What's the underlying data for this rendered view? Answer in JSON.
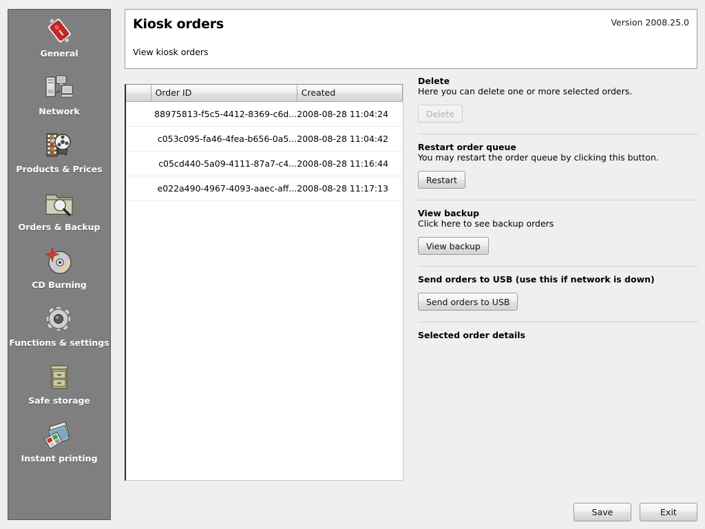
{
  "sidebar": {
    "items": [
      {
        "label": "General",
        "icon": "power-switch-icon"
      },
      {
        "label": "Network",
        "icon": "network-computers-icon"
      },
      {
        "label": "Products & Prices",
        "icon": "film-reel-icon"
      },
      {
        "label": "Orders & Backup",
        "icon": "folder-search-icon"
      },
      {
        "label": "CD Burning",
        "icon": "cd-disc-icon"
      },
      {
        "label": "Functions & settings",
        "icon": "gear-icon"
      },
      {
        "label": "Safe storage",
        "icon": "file-cabinet-icon"
      },
      {
        "label": "Instant printing",
        "icon": "photo-prints-icon"
      }
    ]
  },
  "header": {
    "title": "Kiosk orders",
    "subtitle": "View kiosk orders",
    "version": "Version 2008.25.0"
  },
  "orders_table": {
    "columns": [
      "",
      "Order ID",
      "Created"
    ],
    "rows": [
      {
        "order_id": "88975813-f5c5-4412-8369-c6d...",
        "created": "2008-08-28 11:04:24"
      },
      {
        "order_id": "c053c095-fa46-4fea-b656-0a5...",
        "created": "2008-08-28 11:04:42"
      },
      {
        "order_id": "c05cd440-5a09-4111-87a7-c4...",
        "created": "2008-08-28 11:16:44"
      },
      {
        "order_id": "e022a490-4967-4093-aaec-aff...",
        "created": "2008-08-28 11:17:13"
      }
    ]
  },
  "panel": {
    "delete": {
      "title": "Delete",
      "description": "Here you can delete one or more selected orders.",
      "button": "Delete"
    },
    "restart": {
      "title": "Restart order queue",
      "description": "You may restart the order queue by clicking this button.",
      "button": "Restart"
    },
    "backup": {
      "title": "View backup",
      "description": "Click here to see backup orders",
      "button": "View backup"
    },
    "usb": {
      "title": "Send orders to USB (use this if network is down)",
      "button": "Send orders to USB"
    },
    "details": {
      "title": "Selected order details"
    }
  },
  "footer": {
    "save": "Save",
    "exit": "Exit"
  },
  "colors": {
    "sidebar_bg": "#7f7f7f",
    "app_bg": "#efefef",
    "panel_bg": "#ffffff",
    "accent_red": "#c0201c"
  }
}
